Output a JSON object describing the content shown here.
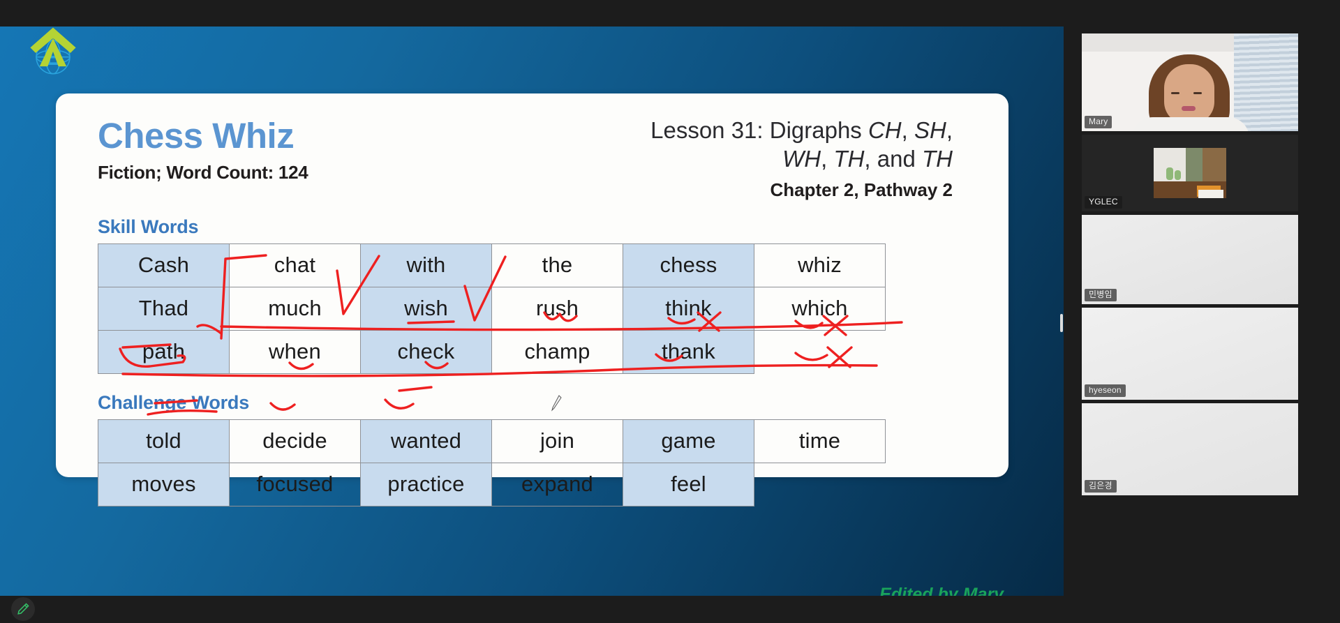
{
  "slide": {
    "title": "Chess Whiz",
    "subtitle": "Fiction; Word Count: 124",
    "lesson_prefix": "Lesson 31: Digraphs ",
    "lesson_d1": "CH",
    "lesson_sep1": ", ",
    "lesson_d2": "SH",
    "lesson_sep2": ", ",
    "lesson_d3": "WH",
    "lesson_sep3": ", ",
    "lesson_d4": "TH",
    "lesson_sep4": ", and ",
    "lesson_d5": "TH",
    "chapter": "Chapter 2, Pathway 2",
    "skill_heading": "Skill Words",
    "challenge_heading": "Challenge Words",
    "credit": "Edited by Mary",
    "accent_title_color": "#5b95d1",
    "accent_heading_color": "#3a79bd",
    "cell_shade_color": "#c8dbee",
    "ink_color": "#ee2020",
    "credit_color": "#1aa35a",
    "skill_words": [
      [
        "Cash",
        "chat",
        "with",
        "the",
        "chess",
        "whiz"
      ],
      [
        "Thad",
        "much",
        "wish",
        "rush",
        "think",
        "which"
      ],
      [
        "path",
        "when",
        "check",
        "champ",
        "thank",
        ""
      ]
    ],
    "challenge_words": [
      [
        "told",
        "decide",
        "wanted",
        "join",
        "game",
        "time"
      ],
      [
        "moves",
        "focused",
        "practice",
        "expand",
        "feel",
        ""
      ]
    ]
  },
  "participants": [
    {
      "name": "Mary",
      "state": "active-speaker"
    },
    {
      "name": "YGLEC",
      "state": "video-small"
    },
    {
      "name": "민병임",
      "state": "video"
    },
    {
      "name": "hyeseon",
      "state": "video"
    },
    {
      "name": "김은경",
      "state": "video"
    }
  ],
  "toolbar": {
    "annotate_icon": "pencil-icon"
  },
  "icons": {
    "logo": "globe-arrow-logo",
    "cursor": "pen-cursor"
  }
}
